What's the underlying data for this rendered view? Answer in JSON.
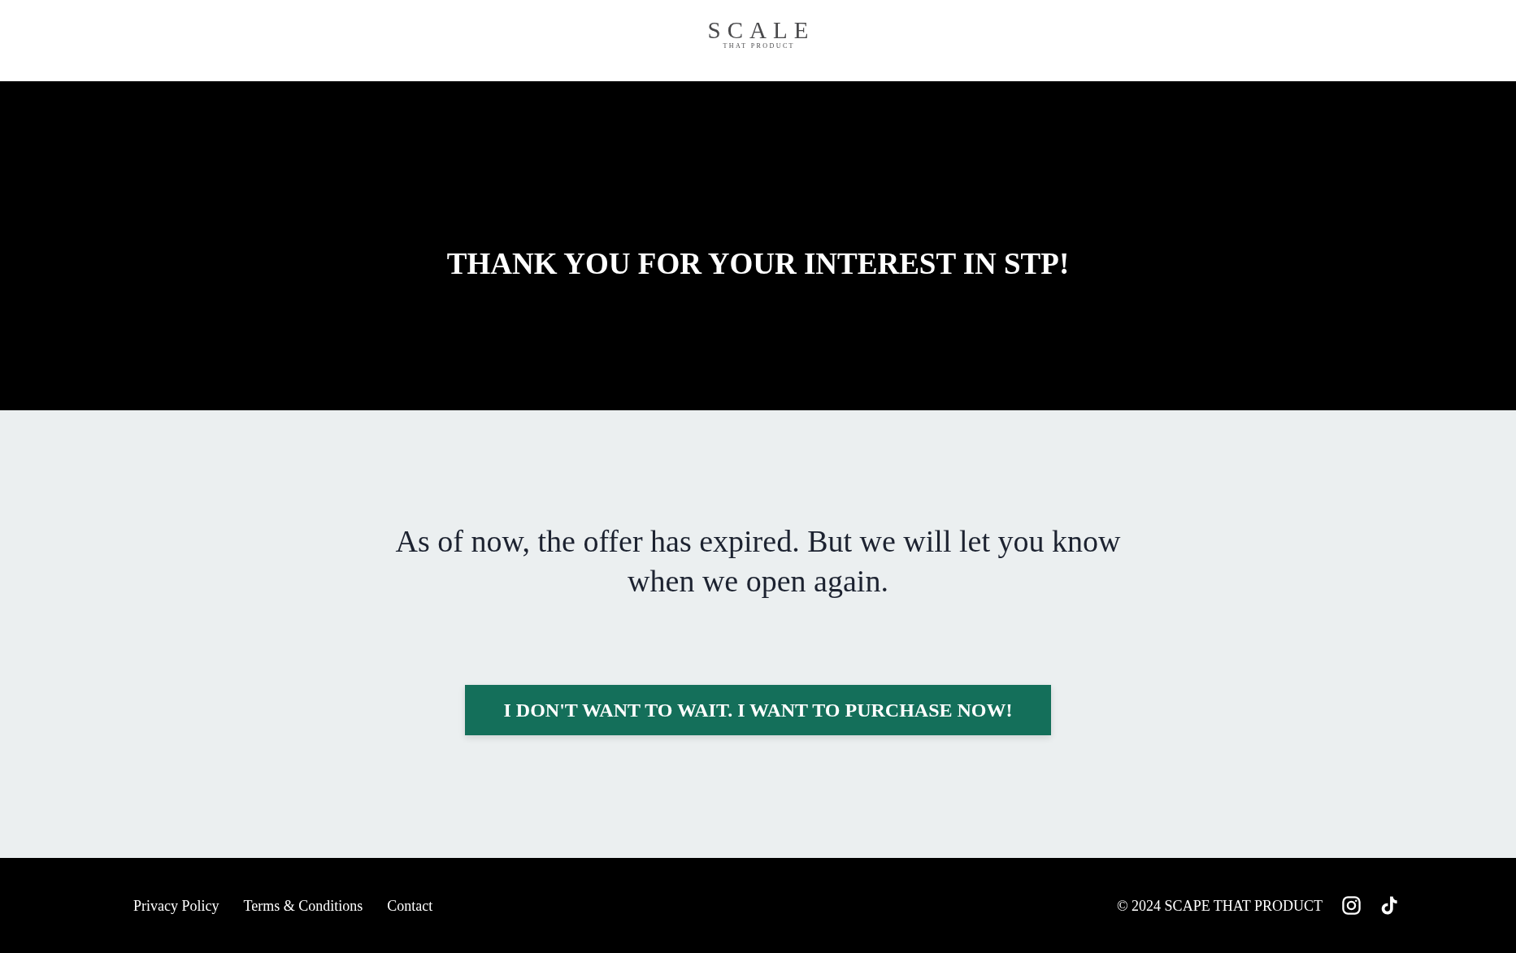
{
  "header": {
    "logo": {
      "title": "SCALE",
      "subtitle": "THAT PRODUCT"
    }
  },
  "hero": {
    "title": "THANK YOU FOR YOUR INTEREST IN STP!"
  },
  "message": {
    "text": "As of now, the offer has expired. But we will let you know when we open again.",
    "button": "I DON'T WANT TO WAIT. I WANT TO PURCHASE NOW!"
  },
  "footer": {
    "links": [
      "Privacy Policy",
      "Terms & Conditions",
      "Contact"
    ],
    "copyright": "© 2024 SCAPE THAT PRODUCT",
    "social": [
      {
        "kind": "instagram"
      },
      {
        "kind": "tiktok"
      }
    ]
  }
}
